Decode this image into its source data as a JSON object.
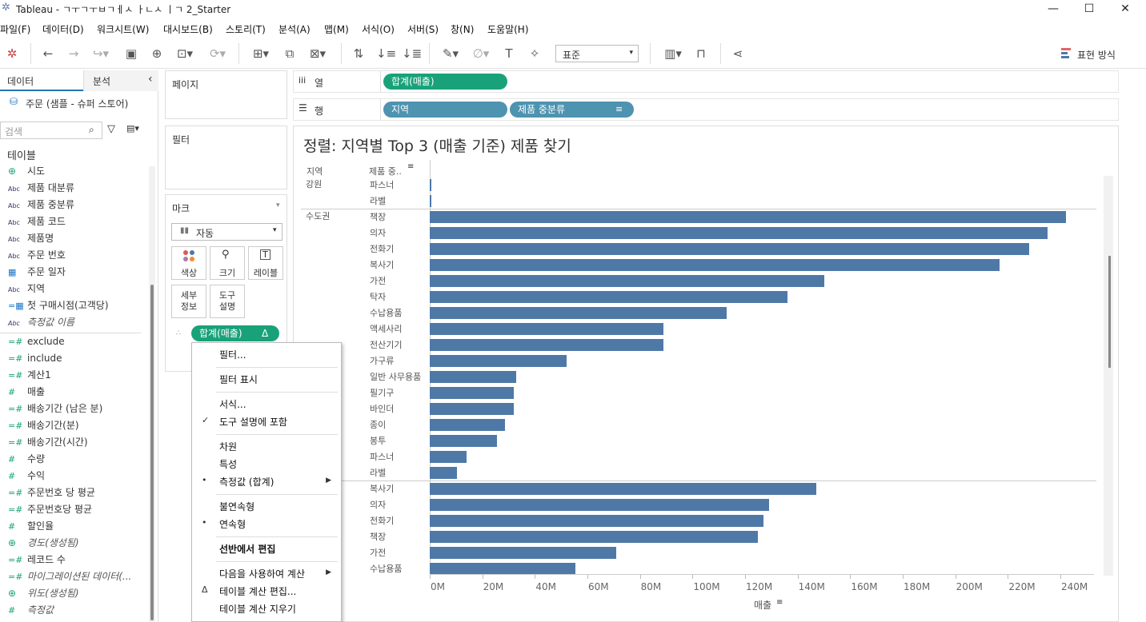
{
  "window": {
    "title": "Tableau - ㄱㅜㄱㅜㅂㄱㅔㅅ ㅏㄴㅅ ㅣㄱ 2_Starter",
    "minimize": "—",
    "maximize": "☐",
    "close": "✕"
  },
  "menu": [
    "파일(F)",
    "데이터(D)",
    "워크시트(W)",
    "대시보드(B)",
    "스토리(T)",
    "분석(A)",
    "맵(M)",
    "서식(O)",
    "서버(S)",
    "창(N)",
    "도움말(H)"
  ],
  "toolbar": {
    "fit_value": "표준",
    "show_me": "표현 방식"
  },
  "left": {
    "tab_data": "데이터",
    "tab_analysis": "분석",
    "datasource": "주문 (샘플 - 슈퍼 스토어)",
    "search_placeholder": "검색",
    "tables_header": "테이블",
    "dimensions": [
      {
        "icon": "globe",
        "label": "시도"
      },
      {
        "icon": "Abc",
        "label": "제품 대분류"
      },
      {
        "icon": "Abc",
        "label": "제품 중분류"
      },
      {
        "icon": "Abc",
        "label": "제품 코드"
      },
      {
        "icon": "Abc",
        "label": "제품명"
      },
      {
        "icon": "Abc",
        "label": "주문 번호"
      },
      {
        "icon": "calendar",
        "label": "주문 일자"
      },
      {
        "icon": "Abc",
        "label": "지역"
      },
      {
        "icon": "calc-date",
        "label": "첫 구매시점(고객당)"
      },
      {
        "icon": "Abc",
        "label": "측정값 이름",
        "italic": true
      }
    ],
    "measures": [
      {
        "icon": "=#",
        "label": "exclude"
      },
      {
        "icon": "=#",
        "label": "include"
      },
      {
        "icon": "=#",
        "label": "계산1"
      },
      {
        "icon": "#",
        "label": "매출"
      },
      {
        "icon": "=#",
        "label": "배송기간 (남은 분)"
      },
      {
        "icon": "=#",
        "label": "배송기간(분)"
      },
      {
        "icon": "=#",
        "label": "배송기간(시간)"
      },
      {
        "icon": "#",
        "label": "수량"
      },
      {
        "icon": "#",
        "label": "수익"
      },
      {
        "icon": "=#",
        "label": "주문번호 당 평균"
      },
      {
        "icon": "=#",
        "label": "주문번호당 평균"
      },
      {
        "icon": "#",
        "label": "할인율"
      },
      {
        "icon": "globe",
        "label": "경도(생성됨)",
        "italic": true
      },
      {
        "icon": "=#",
        "label": "레코드 수"
      },
      {
        "icon": "=#",
        "label": "마이그레이션된 데이터(...",
        "italic": true
      },
      {
        "icon": "globe",
        "label": "위도(생성됨)",
        "italic": true
      },
      {
        "icon": "#",
        "label": "측정값",
        "italic": true
      }
    ]
  },
  "cards": {
    "pages": "페이지",
    "filters": "필터",
    "marks": "마크",
    "mark_type": "자동",
    "color": "색상",
    "size": "크기",
    "label": "레이블",
    "detail": "세부\n정보",
    "tooltip": "도구\n설명",
    "mark_pill": "합계(매출)",
    "mark_pill_delta": "Δ"
  },
  "shelves": {
    "columns_label": "열",
    "rows_label": "행",
    "columns_pill": "합계(매출)",
    "rows_pills": [
      "지역",
      "제품 중분류"
    ]
  },
  "context_menu": [
    {
      "label": "필터...",
      "mark": ""
    },
    {
      "sep": true
    },
    {
      "label": "필터 표시",
      "mark": ""
    },
    {
      "sep": true
    },
    {
      "label": "서식...",
      "mark": ""
    },
    {
      "label": "도구 설명에 포함",
      "mark": "✓"
    },
    {
      "sep": true
    },
    {
      "label": "차원",
      "mark": ""
    },
    {
      "label": "특성",
      "mark": ""
    },
    {
      "label": "측정값 (합계)",
      "mark": "•",
      "sub": true
    },
    {
      "sep": true
    },
    {
      "label": "불연속형",
      "mark": ""
    },
    {
      "label": "연속형",
      "mark": "•"
    },
    {
      "sep": true
    },
    {
      "label": "선반에서 편집",
      "mark": "",
      "bold": true
    },
    {
      "sep": true
    },
    {
      "label": "다음을 사용하여 계산",
      "mark": "",
      "sub": true
    },
    {
      "label": "테이블 계산 편집...",
      "mark": "Δ"
    },
    {
      "label": "테이블 계산 지우기",
      "mark": ""
    }
  ],
  "chart_data": {
    "type": "bar",
    "title": "정렬: 지역별 Top 3 (매출 기준) 제품 찾기",
    "xlabel": "매출",
    "row_headers": [
      "지역",
      "제품 중.."
    ],
    "xlim": [
      0,
      250000000
    ],
    "xticks": [
      "0M",
      "20M",
      "40M",
      "60M",
      "80M",
      "100M",
      "120M",
      "140M",
      "160M",
      "180M",
      "200M",
      "220M",
      "240M"
    ],
    "groups": [
      {
        "name": "강원",
        "items": [
          [
            "파스너",
            400000
          ],
          [
            "라벨",
            300000
          ]
        ]
      },
      {
        "name": "수도권",
        "items": [
          [
            "책장",
            242000000
          ],
          [
            "의자",
            235000000
          ],
          [
            "전화기",
            228000000
          ],
          [
            "복사기",
            217000000
          ],
          [
            "가전",
            150000000
          ],
          [
            "탁자",
            136000000
          ],
          [
            "수납용품",
            113000000
          ],
          [
            "액세사리",
            89000000
          ],
          [
            "전산기기",
            89000000
          ],
          [
            "가구류",
            52000000
          ],
          [
            "일반 사무용품",
            33000000
          ],
          [
            "필기구",
            32000000
          ],
          [
            "바인더",
            32000000
          ],
          [
            "종이",
            28500000
          ],
          [
            "봉투",
            25500000
          ],
          [
            "파스너",
            14000000
          ],
          [
            "라벨",
            10500000
          ]
        ]
      },
      {
        "name": "",
        "items": [
          [
            "복사기",
            147000000
          ],
          [
            "의자",
            129000000
          ],
          [
            "전화기",
            127000000
          ],
          [
            "책장",
            125000000
          ],
          [
            "가전",
            71000000
          ],
          [
            "수납용품",
            55500000
          ]
        ]
      }
    ]
  }
}
